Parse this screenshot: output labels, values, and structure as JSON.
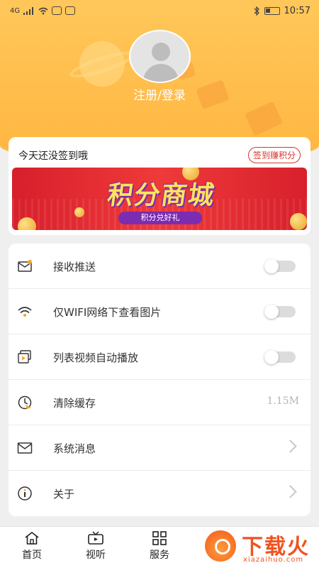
{
  "status_bar": {
    "network": "4G",
    "time": "10:57"
  },
  "profile": {
    "login_label": "注册/登录"
  },
  "checkin": {
    "title": "今天还没签到哦",
    "button_label": "签到赚积分",
    "banner_title": "积分商城",
    "banner_subtitle": "积分兑好礼"
  },
  "settings": {
    "items": [
      {
        "label": "接收推送",
        "icon": "message-icon",
        "control": "toggle",
        "on": false
      },
      {
        "label": "仅WIFI网络下查看图片",
        "icon": "wifi-icon",
        "control": "toggle",
        "on": false
      },
      {
        "label": "列表视频自动播放",
        "icon": "video-play-icon",
        "control": "toggle",
        "on": false
      },
      {
        "label": "清除缓存",
        "icon": "clear-cache-icon",
        "control": "value",
        "value": "1.15M"
      },
      {
        "label": "系统消息",
        "icon": "mail-icon",
        "control": "chevron"
      },
      {
        "label": "关于",
        "icon": "info-icon",
        "control": "chevron"
      }
    ]
  },
  "tabbar": {
    "tabs": [
      {
        "label": "首页",
        "icon": "home-icon"
      },
      {
        "label": "视听",
        "icon": "tv-icon"
      },
      {
        "label": "服务",
        "icon": "grid-icon"
      }
    ]
  },
  "watermark": {
    "text": "下载火",
    "domain": "xiazaihuo.com"
  },
  "colors": {
    "header": "#ffb640",
    "accent_red": "#d8332a",
    "banner_purple": "#7b2cb0",
    "watermark_orange": "#f0531f"
  }
}
